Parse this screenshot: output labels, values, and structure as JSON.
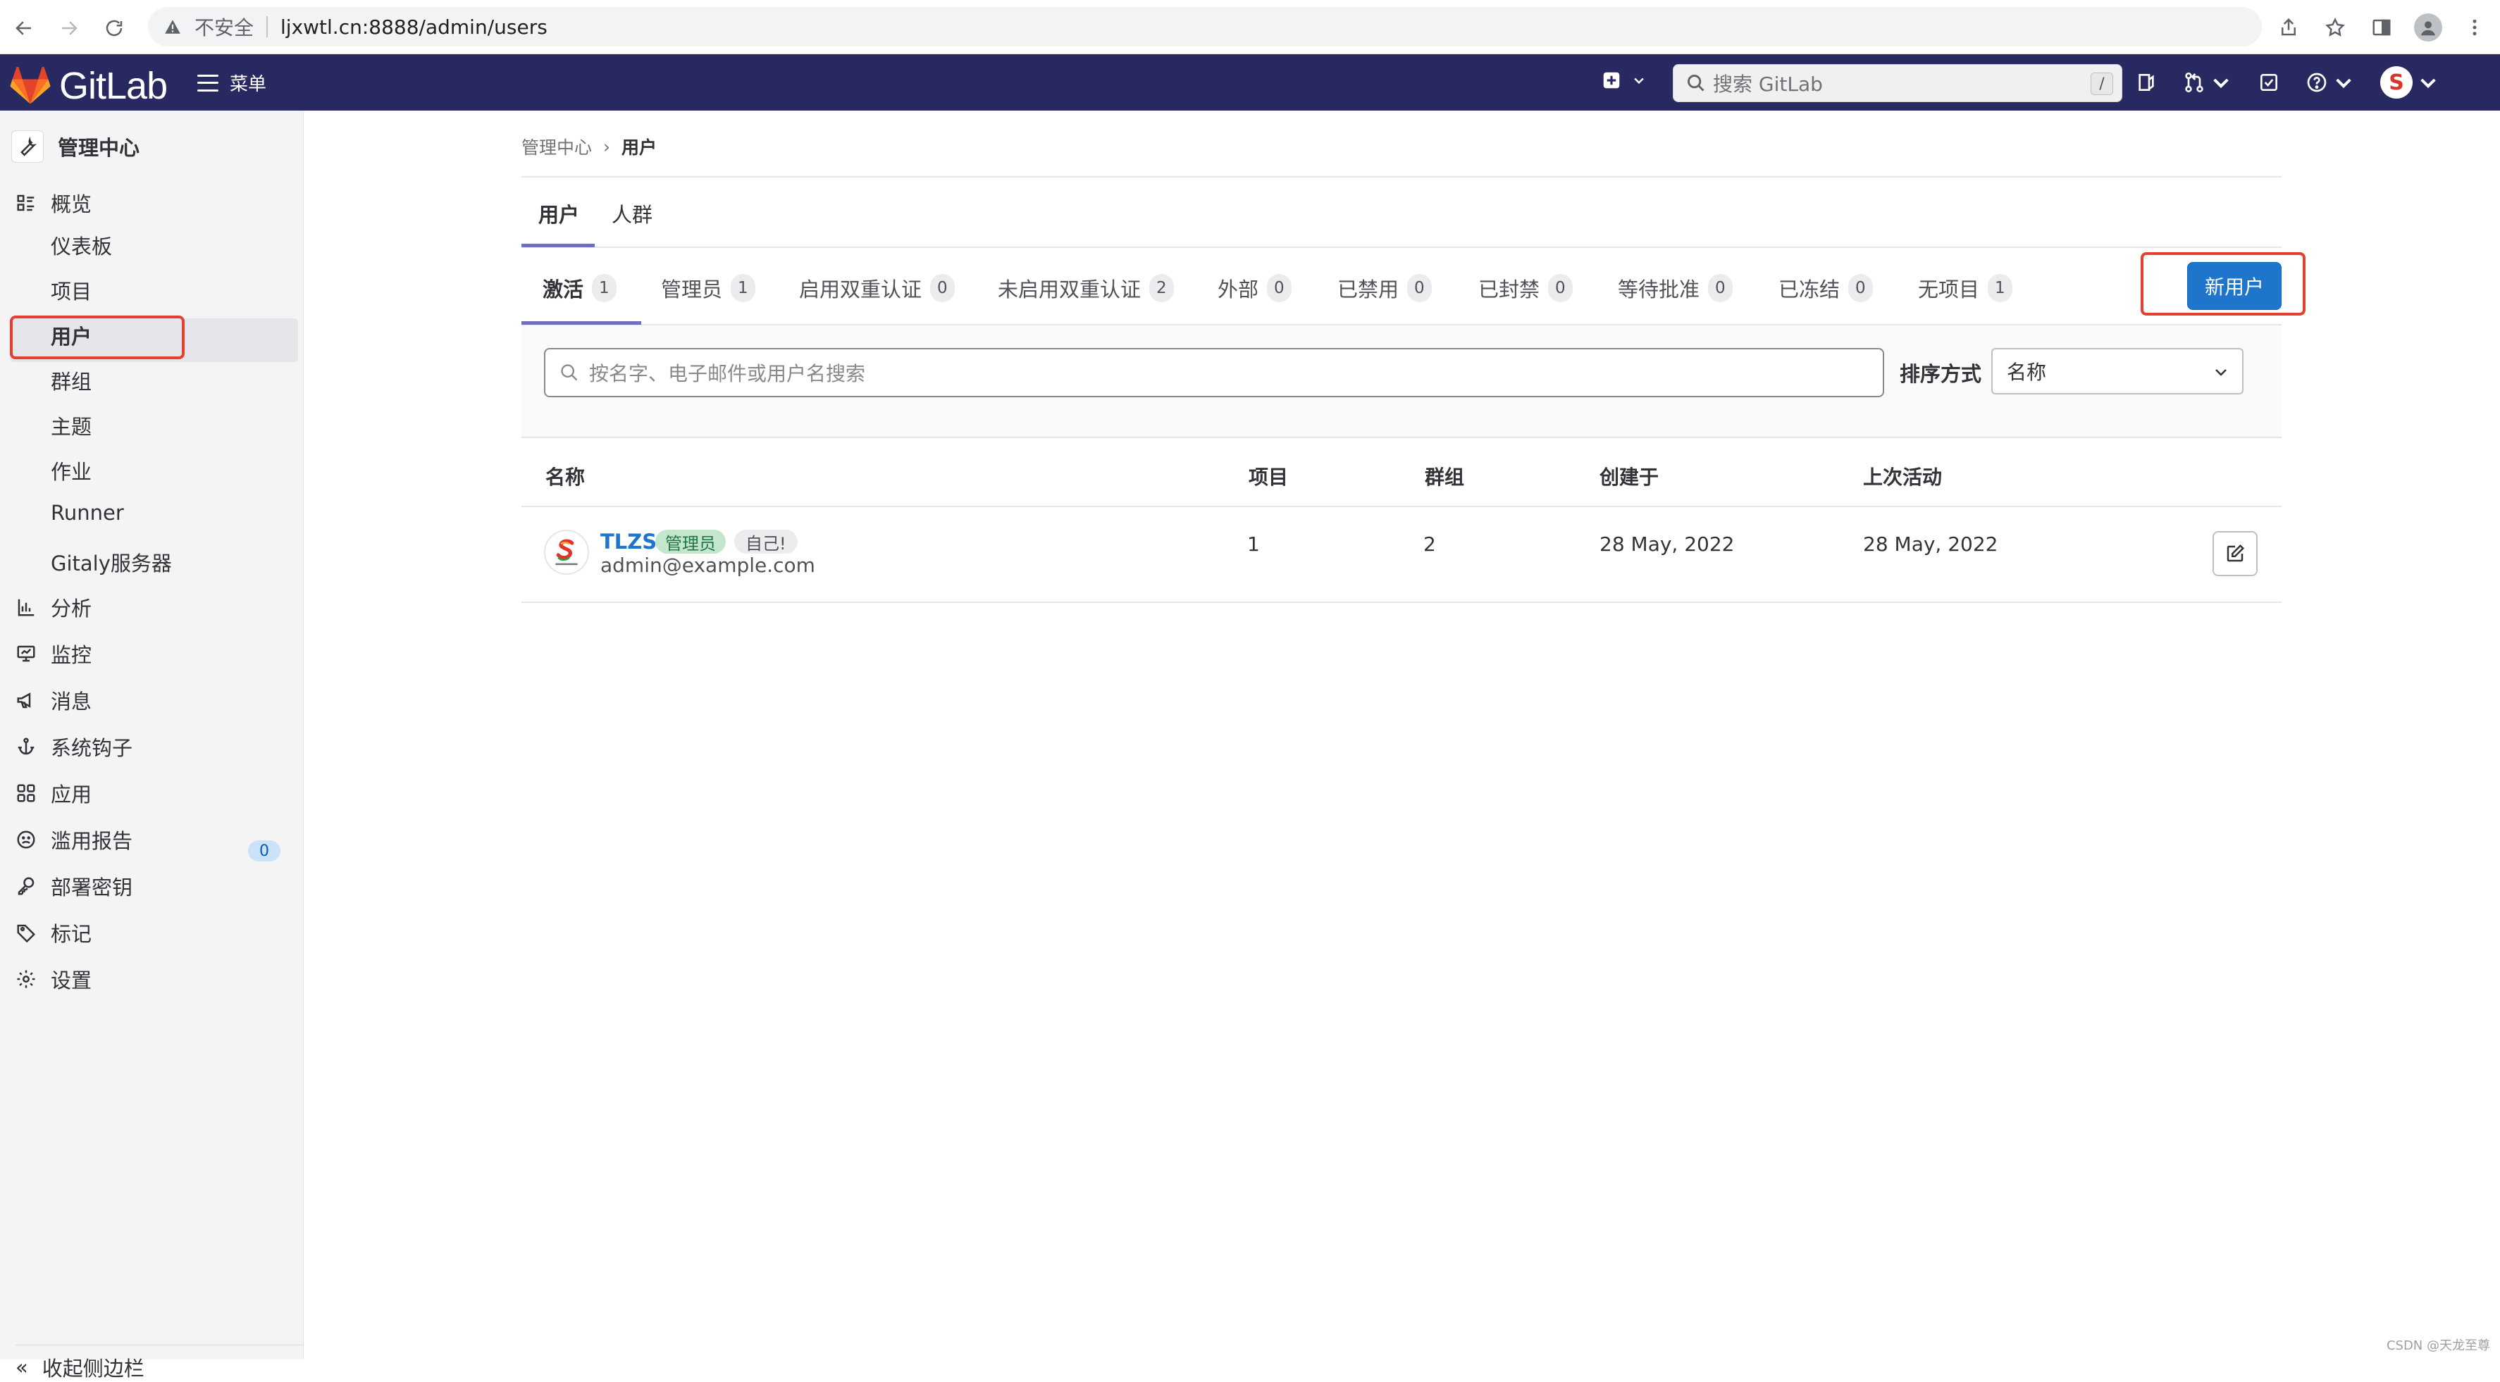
{
  "browser": {
    "insecure_label": "不安全",
    "url": "ljxwtl.cn:8888/admin/users"
  },
  "topnav": {
    "brand": "GitLab",
    "menu_label": "菜单",
    "search_placeholder": "搜索 GitLab",
    "search_shortcut": "/",
    "avatar_letter": "S"
  },
  "sidebar": {
    "header": "管理中心",
    "overview": "概览",
    "items": [
      {
        "label": "仪表板"
      },
      {
        "label": "项目"
      },
      {
        "label": "用户"
      },
      {
        "label": "群组"
      },
      {
        "label": "主题"
      },
      {
        "label": "作业"
      },
      {
        "label": "Runner"
      },
      {
        "label": "Gitaly服务器"
      }
    ],
    "sections": [
      {
        "label": "分析",
        "icon": "chart-icon"
      },
      {
        "label": "监控",
        "icon": "monitor-icon"
      },
      {
        "label": "消息",
        "icon": "bullhorn-icon"
      },
      {
        "label": "系统钩子",
        "icon": "anchor-icon"
      },
      {
        "label": "应用",
        "icon": "apps-icon"
      },
      {
        "label": "滥用报告",
        "icon": "abuse-icon",
        "badge": "0"
      },
      {
        "label": "部署密钥",
        "icon": "key-icon"
      },
      {
        "label": "标记",
        "icon": "label-icon"
      },
      {
        "label": "设置",
        "icon": "gear-icon"
      }
    ],
    "collapse_label": "收起侧边栏"
  },
  "breadcrumb": {
    "parent": "管理中心",
    "current": "用户"
  },
  "tabs": {
    "users": "用户",
    "cohorts": "人群"
  },
  "filters": [
    {
      "label": "激活",
      "count": "1"
    },
    {
      "label": "管理员",
      "count": "1"
    },
    {
      "label": "启用双重认证",
      "count": "0"
    },
    {
      "label": "未启用双重认证",
      "count": "2"
    },
    {
      "label": "外部",
      "count": "0"
    },
    {
      "label": "已禁用",
      "count": "0"
    },
    {
      "label": "已封禁",
      "count": "0"
    },
    {
      "label": "等待批准",
      "count": "0"
    },
    {
      "label": "已冻结",
      "count": "0"
    },
    {
      "label": "无项目",
      "count": "1"
    }
  ],
  "new_user_button": "新用户",
  "search": {
    "placeholder": "按名字、电子邮件或用户名搜索"
  },
  "sort": {
    "label": "排序方式",
    "selected": "名称"
  },
  "table": {
    "headers": {
      "name": "名称",
      "projects": "项目",
      "groups": "群组",
      "created": "创建于",
      "last_activity": "上次活动"
    },
    "rows": [
      {
        "name": "TLZS",
        "badge_admin": "管理员",
        "badge_self": "自己!",
        "email": "admin@example.com",
        "projects": "1",
        "groups": "2",
        "created": "28 May, 2022",
        "last_activity": "28 May, 2022"
      }
    ]
  },
  "watermark": "CSDN @天龙至尊",
  "colors": {
    "nav_bg": "#292961",
    "primary": "#1f75cb",
    "highlight_box": "#e3402f",
    "tab_underline": "#6f6fbf"
  }
}
